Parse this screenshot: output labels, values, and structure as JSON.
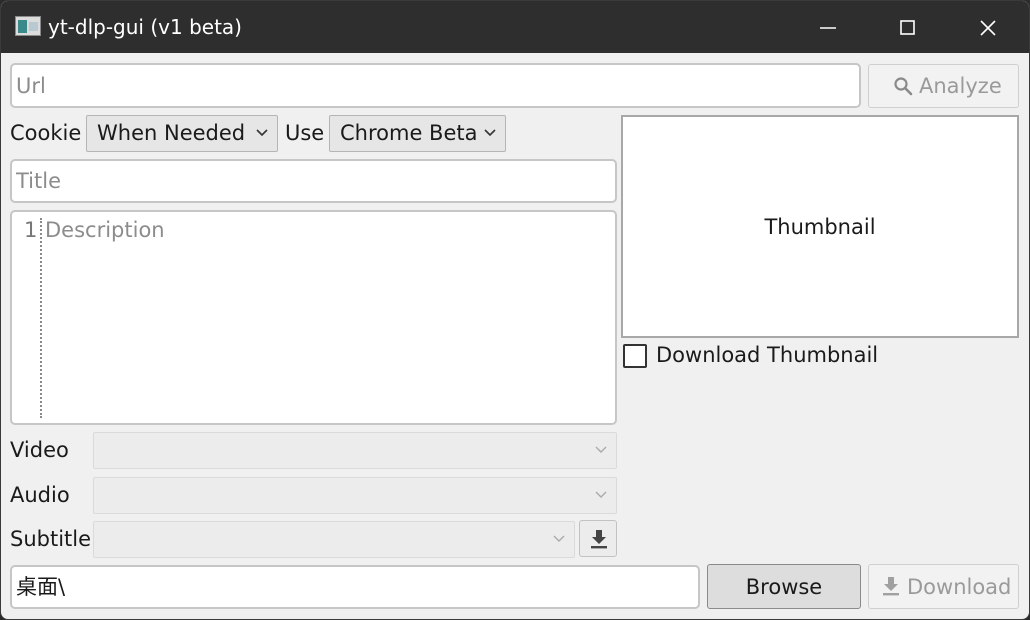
{
  "window": {
    "title": "yt-dlp-gui (v1 beta)"
  },
  "url": {
    "placeholder": "Url",
    "value": ""
  },
  "analyze_button": {
    "label": "Analyze",
    "icon": "search-icon"
  },
  "cookie": {
    "label": "Cookie",
    "mode_selected": "When Needed",
    "use_label": "Use",
    "browser_selected": "Chrome Beta"
  },
  "title_field": {
    "placeholder": "Title",
    "value": ""
  },
  "description": {
    "line_number": "1",
    "placeholder": "Description"
  },
  "thumbnail": {
    "placeholder_text": "Thumbnail",
    "download_checkbox_label": "Download Thumbnail",
    "download_checked": false
  },
  "formats": {
    "video_label": "Video",
    "audio_label": "Audio",
    "subtitle_label": "Subtitle",
    "video_selected": "",
    "audio_selected": "",
    "subtitle_selected": ""
  },
  "subtitle_download_icon": "download-icon",
  "output": {
    "path": "桌面\\",
    "browse_label": "Browse",
    "download_label": "Download",
    "download_icon": "download-icon"
  }
}
